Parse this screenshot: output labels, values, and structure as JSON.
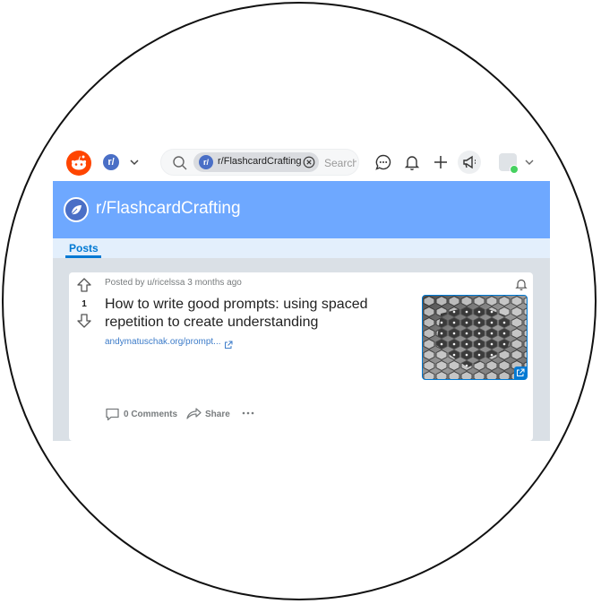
{
  "header": {
    "logo_icon": "reddit-logo-icon",
    "community_icon_letter": "r/",
    "search": {
      "chip_icon_letter": "r/",
      "chip_label": "r/FlashcardCrafting",
      "placeholder": "Search"
    },
    "icons": [
      "chat-icon",
      "bell-icon",
      "plus-icon",
      "megaphone-icon"
    ]
  },
  "banner": {
    "title": "r/FlashcardCrafting"
  },
  "tabs": [
    {
      "label": "Posts",
      "active": true
    }
  ],
  "post": {
    "score": "1",
    "meta": "Posted by u/ricelssa 3 months ago",
    "title": "How to write good prompts: using spaced repetition to create understanding",
    "link": "andymatuschak.org/prompt...",
    "comments_label": "0 Comments",
    "share_label": "Share"
  },
  "colors": {
    "brand": "#ff4500",
    "banner": "#6ea8ff",
    "accent": "#0079d3",
    "feed_bg": "#dae0e6"
  }
}
